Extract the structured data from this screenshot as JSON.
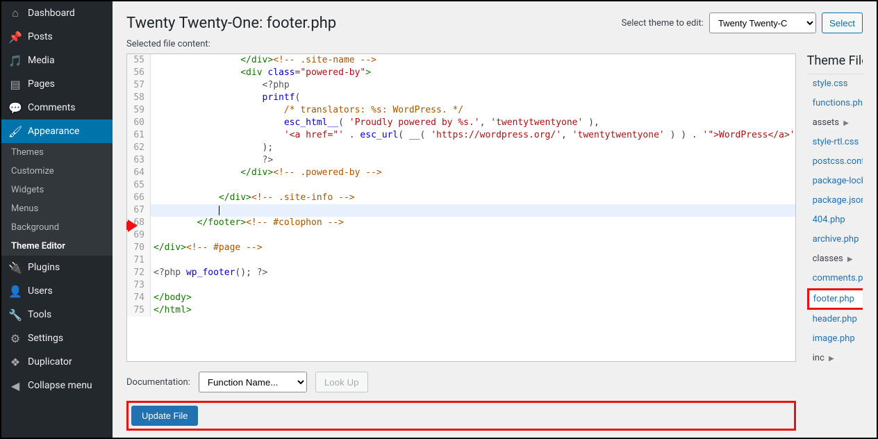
{
  "sidebar": {
    "dashboard": "Dashboard",
    "posts": "Posts",
    "media": "Media",
    "pages": "Pages",
    "comments": "Comments",
    "appearance": "Appearance",
    "sub": {
      "themes": "Themes",
      "customize": "Customize",
      "widgets": "Widgets",
      "menus": "Menus",
      "background": "Background",
      "theme_editor": "Theme Editor"
    },
    "plugins": "Plugins",
    "users": "Users",
    "tools": "Tools",
    "settings": "Settings",
    "duplicator": "Duplicator",
    "collapse": "Collapse menu"
  },
  "header": {
    "title": "Twenty Twenty-One: footer.php",
    "select_label": "Select theme to edit:",
    "theme_selected": "Twenty Twenty-C",
    "select_btn": "Select"
  },
  "selected_file_label": "Selected file content:",
  "file_panel_title": "Theme Files",
  "files": {
    "style": "style.css",
    "functions": "functions.php",
    "assets": "assets",
    "style_rtl": "style-rtl.css",
    "postcss": "postcss.config.js",
    "pkglock": "package-lock.json",
    "pkg": "package.json",
    "f404": "404.php",
    "archive": "archive.php",
    "classes": "classes",
    "comments": "comments.php",
    "footer": "footer.php",
    "header": "header.php",
    "image": "image.php",
    "inc": "inc"
  },
  "bottom": {
    "doc_label": "Documentation:",
    "doc_select": "Function Name...",
    "lookup": "Look Up",
    "update": "Update File"
  },
  "code": {
    "lines": [
      {
        "n": 55,
        "html": "                <span class='c-tag'>&lt;/div&gt;</span><span class='c-com'>&lt;!-- .site-name --&gt;</span>"
      },
      {
        "n": 56,
        "html": "                <span class='c-tag'>&lt;div</span> <span class='c-attr'>class</span>=<span class='c-str'>\"powered-by\"</span><span class='c-tag'>&gt;</span>"
      },
      {
        "n": 57,
        "html": "                    <span class='c-php'>&lt;?php</span>"
      },
      {
        "n": 58,
        "html": "                    <span class='c-fn'>printf</span>("
      },
      {
        "n": 59,
        "html": "                        <span class='c-com'>/* translators: %s: WordPress. */</span>"
      },
      {
        "n": 60,
        "html": "                        <span class='c-fn'>esc_html__</span>( <span class='c-str'>'Proudly powered by %s.'</span>, <span class='c-str'>'twentytwentyone'</span> ),"
      },
      {
        "n": 61,
        "html": "                        <span class='c-str'>'&lt;a href=\"'</span> . <span class='c-fn'>esc_url</span>( <span class='c-fn'>__</span>( <span class='c-str'>'https://wordpress.org/'</span>, <span class='c-str'>'twentytwentyone'</span> ) ) . <span class='c-str'>'\"&gt;WordPress&lt;/a&gt;'</span>"
      },
      {
        "n": 62,
        "html": "                    );"
      },
      {
        "n": 63,
        "html": "                    <span class='c-php'>?&gt;</span>"
      },
      {
        "n": 64,
        "html": "                <span class='c-tag'>&lt;/div&gt;</span><span class='c-com'>&lt;!-- .powered-by --&gt;</span>"
      },
      {
        "n": 65,
        "html": ""
      },
      {
        "n": 66,
        "html": "            <span class='c-tag'>&lt;/div&gt;</span><span class='c-com'>&lt;!-- .site-info --&gt;</span>"
      },
      {
        "n": 67,
        "html": "            <span class='cursor-line'></span>",
        "hl": true
      },
      {
        "n": 68,
        "html": "        <span class='c-tag'>&lt;/footer&gt;</span><span class='c-com'>&lt;!-- #colophon --&gt;</span>"
      },
      {
        "n": 69,
        "html": ""
      },
      {
        "n": 70,
        "html": "<span class='c-tag'>&lt;/div&gt;</span><span class='c-com'>&lt;!-- #page --&gt;</span>"
      },
      {
        "n": 71,
        "html": ""
      },
      {
        "n": 72,
        "html": "<span class='c-php'>&lt;?php</span> <span class='c-fn'>wp_footer</span>(); <span class='c-php'>?&gt;</span>"
      },
      {
        "n": 73,
        "html": ""
      },
      {
        "n": 74,
        "html": "<span class='c-tag'>&lt;/body&gt;</span>"
      },
      {
        "n": 75,
        "html": "<span class='c-tag'>&lt;/html&gt;</span>"
      }
    ]
  }
}
